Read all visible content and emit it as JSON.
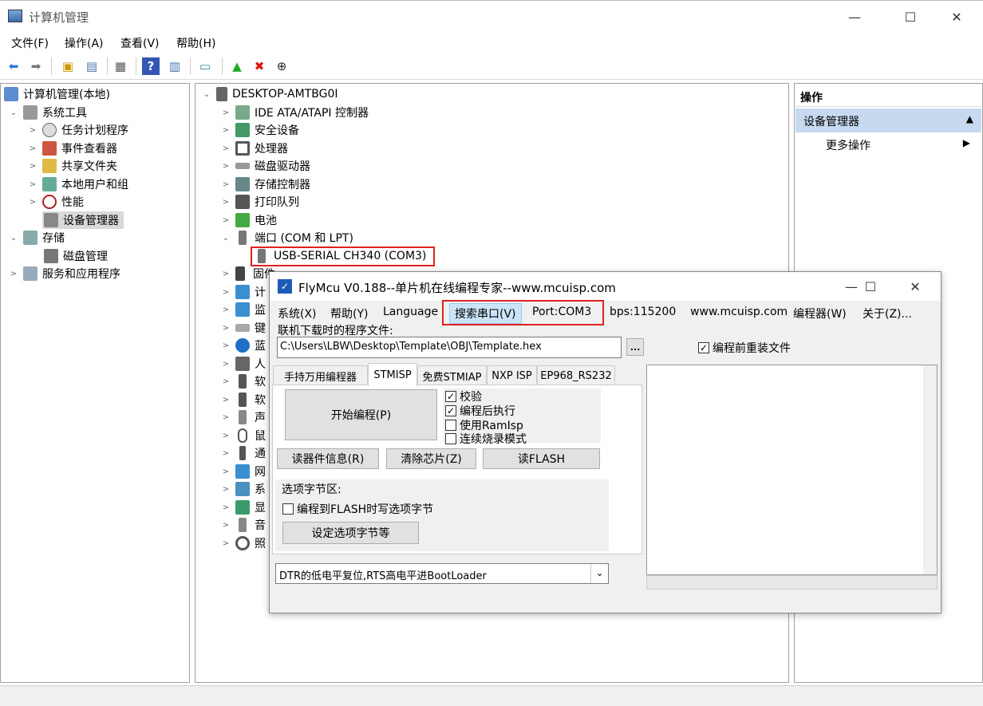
{
  "window": {
    "title": "计算机管理",
    "min": "—",
    "max": "☐",
    "close": "✕"
  },
  "menu": [
    "文件(F)",
    "操作(A)",
    "查看(V)",
    "帮助(H)"
  ],
  "left_tree": [
    {
      "label": "计算机管理(本地)",
      "level": 0,
      "exp": ""
    },
    {
      "label": "系统工具",
      "level": 1,
      "exp": "⌄"
    },
    {
      "label": "任务计划程序",
      "level": 2,
      "exp": ">"
    },
    {
      "label": "事件查看器",
      "level": 2,
      "exp": ">"
    },
    {
      "label": "共享文件夹",
      "level": 2,
      "exp": ">"
    },
    {
      "label": "本地用户和组",
      "level": 2,
      "exp": ">"
    },
    {
      "label": "性能",
      "level": 2,
      "exp": ">"
    },
    {
      "label": "设备管理器",
      "level": 2,
      "exp": ""
    },
    {
      "label": "存储",
      "level": 1,
      "exp": "⌄"
    },
    {
      "label": "磁盘管理",
      "level": 2,
      "exp": ""
    },
    {
      "label": "服务和应用程序",
      "level": 1,
      "exp": ">"
    }
  ],
  "center_tree": [
    {
      "label": "DESKTOP-AMTBG0I",
      "level": 0,
      "exp": "⌄"
    },
    {
      "label": "IDE ATA/ATAPI 控制器",
      "level": 1,
      "exp": ">"
    },
    {
      "label": "安全设备",
      "level": 1,
      "exp": ">"
    },
    {
      "label": "处理器",
      "level": 1,
      "exp": ">"
    },
    {
      "label": "磁盘驱动器",
      "level": 1,
      "exp": ">"
    },
    {
      "label": "存储控制器",
      "level": 1,
      "exp": ">"
    },
    {
      "label": "打印队列",
      "level": 1,
      "exp": ">"
    },
    {
      "label": "电池",
      "level": 1,
      "exp": ">"
    },
    {
      "label": "端口 (COM 和 LPT)",
      "level": 1,
      "exp": "⌄"
    },
    {
      "label": "USB-SERIAL CH340 (COM3)",
      "level": 2,
      "exp": ""
    },
    {
      "label": "固件",
      "level": 1,
      "exp": ">"
    },
    {
      "label": "计",
      "level": 1,
      "exp": ">"
    },
    {
      "label": "监",
      "level": 1,
      "exp": ">"
    },
    {
      "label": "键",
      "level": 1,
      "exp": ">"
    },
    {
      "label": "蓝",
      "level": 1,
      "exp": ">"
    },
    {
      "label": "人",
      "level": 1,
      "exp": ">"
    },
    {
      "label": "软",
      "level": 1,
      "exp": ">"
    },
    {
      "label": "软",
      "level": 1,
      "exp": ">"
    },
    {
      "label": "声",
      "level": 1,
      "exp": ">"
    },
    {
      "label": "鼠",
      "level": 1,
      "exp": ">"
    },
    {
      "label": "通",
      "level": 1,
      "exp": ">"
    },
    {
      "label": "网",
      "level": 1,
      "exp": ">"
    },
    {
      "label": "系",
      "level": 1,
      "exp": ">"
    },
    {
      "label": "显",
      "level": 1,
      "exp": ">"
    },
    {
      "label": "音",
      "level": 1,
      "exp": ">"
    },
    {
      "label": "照",
      "level": 1,
      "exp": ">"
    }
  ],
  "actions": {
    "header": "操作",
    "device_manager": "设备管理器",
    "more": "更多操作",
    "collapse_icon": "▲",
    "more_icon": "▶"
  },
  "fly": {
    "title": "FlyMcu V0.188--单片机在线编程专家--www.mcuisp.com",
    "menu": [
      "系统(X)",
      "帮助(Y)",
      "Language",
      "搜索串口(V)",
      "Port:COM3",
      "bps:115200",
      "www.mcuisp.com",
      "编程器(W)",
      "关于(Z)..."
    ],
    "file_label": "联机下载时的程序文件:",
    "file_path": "C:\\Users\\LBW\\Desktop\\Template\\OBJ\\Template.hex",
    "browse": "...",
    "reload": "编程前重装文件",
    "tabs": [
      "手持万用编程器",
      "STMISP",
      "免费STMIAP",
      "NXP ISP",
      "EP968_RS232"
    ],
    "start": "开始编程(P)",
    "checks": [
      {
        "label": "校验",
        "checked": true
      },
      {
        "label": "编程后执行",
        "checked": true
      },
      {
        "label": "使用RamIsp",
        "checked": false
      },
      {
        "label": "连续烧录模式",
        "checked": false
      }
    ],
    "btn_info": "读器件信息(R)",
    "btn_erase": "清除芯片(Z)",
    "btn_read": "读FLASH",
    "opt_group": "选项字节区:",
    "opt_check": "编程到FLASH时写选项字节",
    "opt_btn": "设定选项字节等",
    "dtr": "DTR的低电平复位,RTS高电平进BootLoader"
  }
}
